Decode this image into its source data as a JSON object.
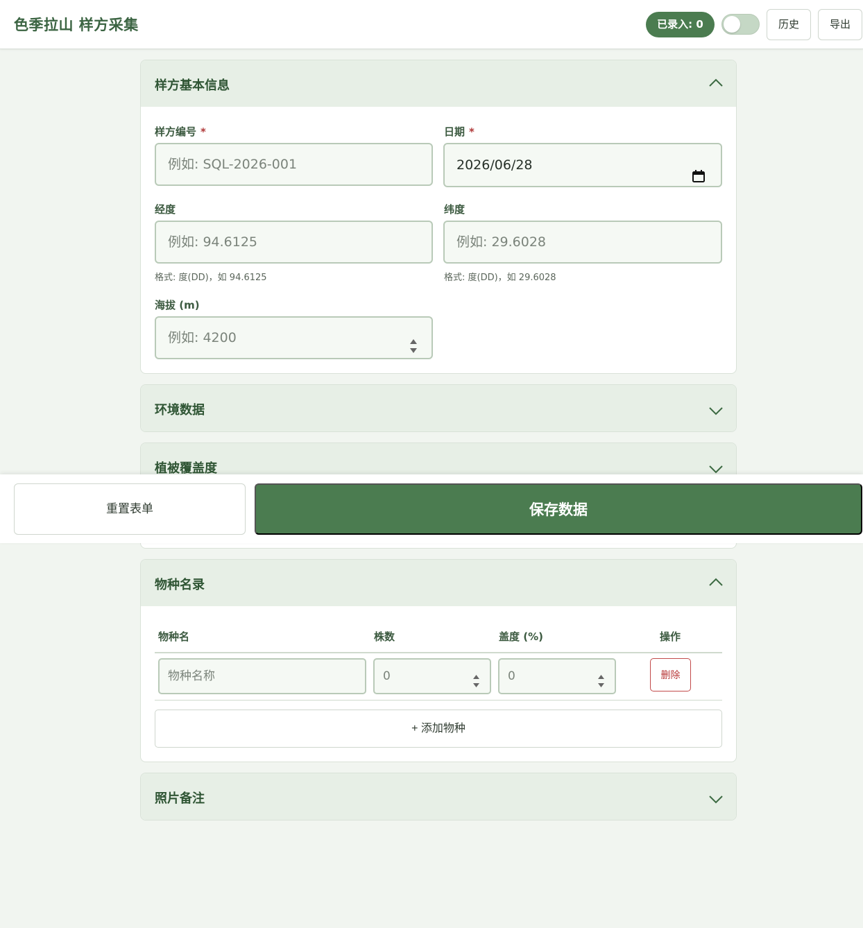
{
  "header": {
    "title": "色季拉山 样方采集",
    "count_badge": "已录入: 0",
    "history_label": "历史",
    "export_label": "导出"
  },
  "basic": {
    "title": "样方基本信息",
    "plot_id": {
      "label": "样方编号",
      "required_mark": "*",
      "placeholder": "例如: SQL-2026-001"
    },
    "date": {
      "label": "日期",
      "required_mark": "*",
      "value": "2026/06/28"
    },
    "longitude": {
      "label": "经度",
      "placeholder": "例如: 94.6125",
      "hint": "格式: 度(DD)，如 94.6125"
    },
    "latitude": {
      "label": "纬度",
      "placeholder": "例如: 29.6028",
      "hint": "格式: 度(DD)，如 29.6028"
    },
    "altitude": {
      "label": "海拔 (m)",
      "placeholder": "例如: 4200"
    }
  },
  "sections": {
    "environment": "环境数据",
    "vegetation": "植被覆盖度",
    "species": "物种名录",
    "photos": "照片备注"
  },
  "species_table": {
    "columns": [
      "物种名",
      "株数",
      "盖度 (%)",
      "操作"
    ],
    "row": {
      "name_placeholder": "物种名称",
      "count_placeholder": "0",
      "cover_placeholder": "0",
      "delete_label": "删除"
    },
    "add_label": "+ 添加物种"
  },
  "actions": {
    "reset_label": "重置表单",
    "save_label": "保存数据"
  },
  "colors": {
    "primary": "#4b7c50",
    "header_bg": "#e7efe6",
    "danger": "#b83a3a"
  }
}
